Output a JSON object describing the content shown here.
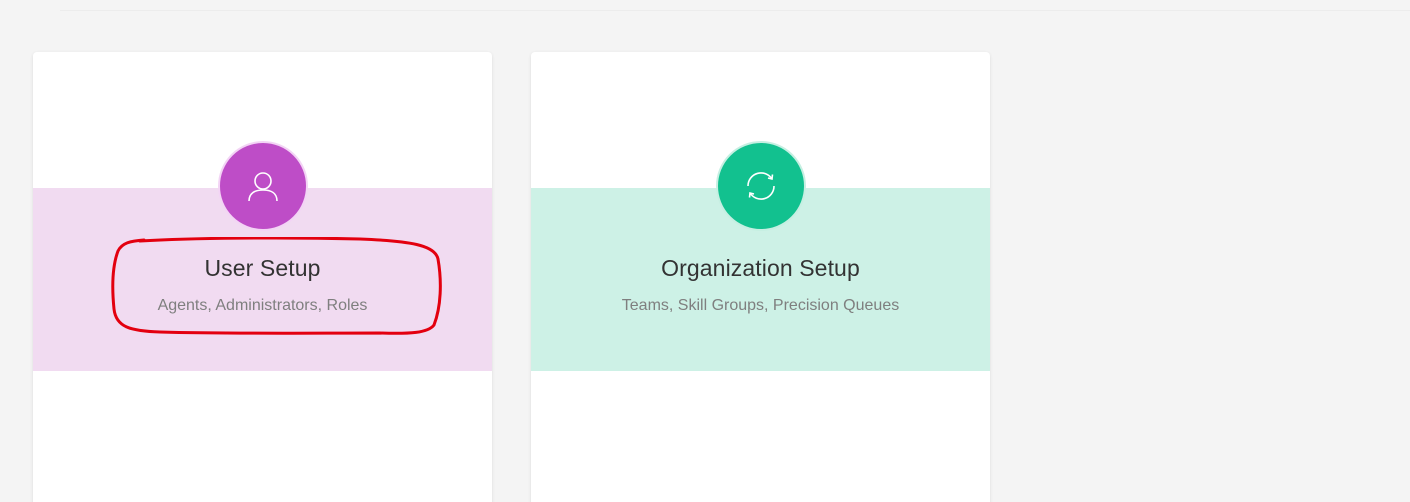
{
  "cards": [
    {
      "title": "User Setup",
      "subtitle": "Agents, Administrators, Roles",
      "icon": "user-icon",
      "accent": "#be4dc7",
      "band_color": "#f1dbf1"
    },
    {
      "title": "Organization Setup",
      "subtitle": "Teams, Skill Groups, Precision Queues",
      "icon": "sync-icon",
      "accent": "#12c18f",
      "band_color": "#cdf1e6"
    }
  ],
  "annotation": {
    "shape": "hand-drawn red outline around User Setup title and subtitle",
    "color": "#e3000f"
  }
}
